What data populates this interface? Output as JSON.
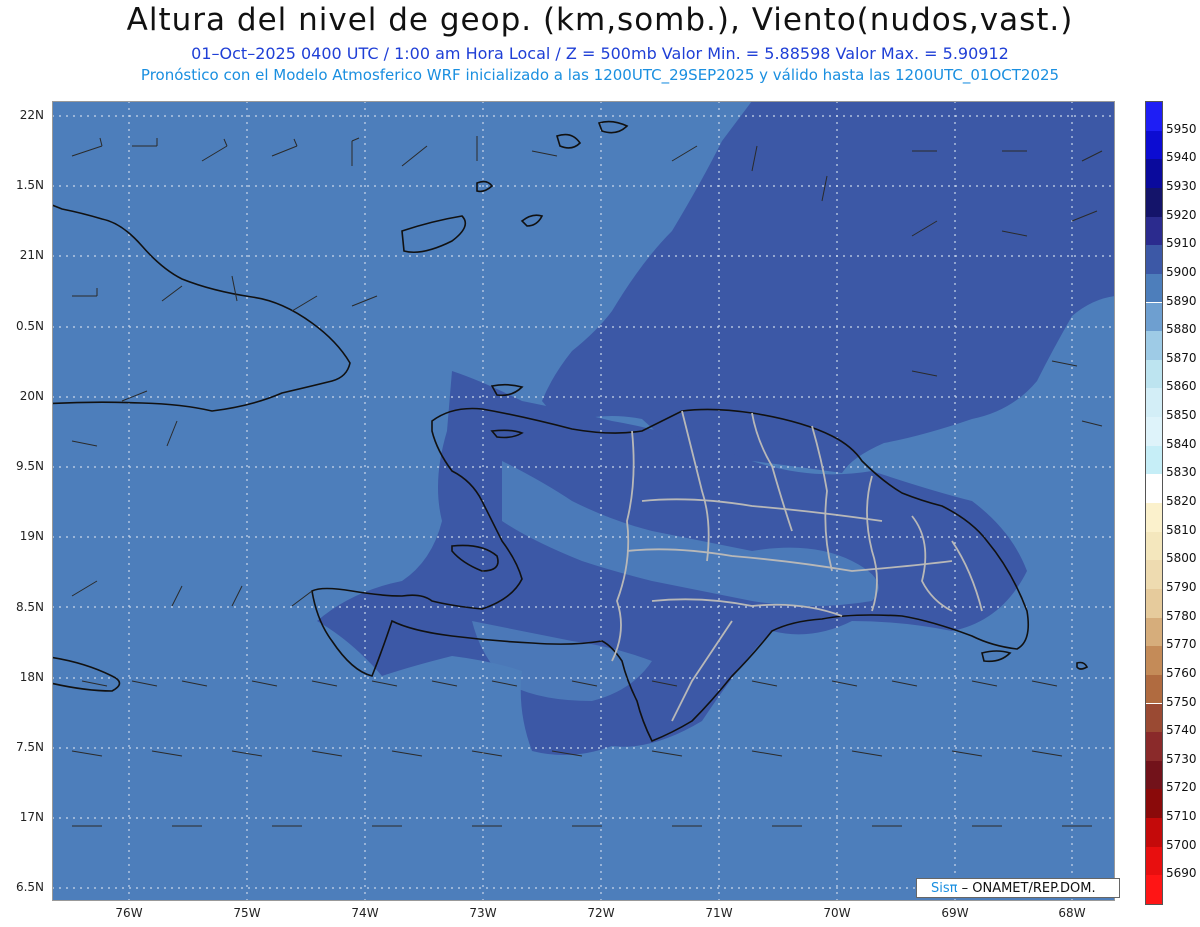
{
  "header": {
    "title": "Altura del nivel de geop. (km,somb.), Viento(nudos,vast.)",
    "subtitle1": "01–Oct–2025  0400 UTC / 1:00 am Hora Local / Z = 500mb     Valor Min. = 5.88598  Valor Max. = 5.90912",
    "subtitle2": "Pronóstico con el Modelo Atmosferico WRF inicializado a las 1200UTC_29SEP2025 y válido hasta las  1200UTC_01OCT2025"
  },
  "map": {
    "lat_labels": [
      "22N",
      "1.5N",
      "21N",
      "0.5N",
      "20N",
      "9.5N",
      "19N",
      "8.5N",
      "18N",
      "7.5N",
      "17N",
      "6.5N"
    ],
    "lon_labels": [
      "76W",
      "75W",
      "74W",
      "73W",
      "72W",
      "71W",
      "70W",
      "69W",
      "68W"
    ],
    "colors": {
      "field_5890": "#4d7ebb",
      "field_5900": "#3c58a6",
      "coast": "#111111",
      "provinces": "#b8b8b8"
    }
  },
  "colorbar": {
    "labels": [
      "5950",
      "5940",
      "5930",
      "5920",
      "5910",
      "5900",
      "5890",
      "5880",
      "5870",
      "5860",
      "5850",
      "5840",
      "5830",
      "5820",
      "5810",
      "5800",
      "5790",
      "5780",
      "5770",
      "5760",
      "5750",
      "5740",
      "5730",
      "5720",
      "5710",
      "5700",
      "5690"
    ],
    "colors": [
      "#1e1ef5",
      "#0c0cd2",
      "#0a0a9c",
      "#14146a",
      "#2b2b8e",
      "#3c58a6",
      "#4d7ebb",
      "#6e9fd0",
      "#9ecbe6",
      "#bde4f0",
      "#d3eef7",
      "#def3fa",
      "#c6eef7",
      "#ffffff",
      "#fbf1cc",
      "#f4e7bd",
      "#eedbb0",
      "#e6cb9c",
      "#d6ad7b",
      "#c48b58",
      "#b06b40",
      "#9a4a33",
      "#8a2a2a",
      "#72121a",
      "#8a0a0a",
      "#c40a0a",
      "#e80f0f",
      "#ff1515"
    ]
  },
  "credit": {
    "sis": "Sisπ",
    "text": "– ONAMET/REP.DOM."
  }
}
